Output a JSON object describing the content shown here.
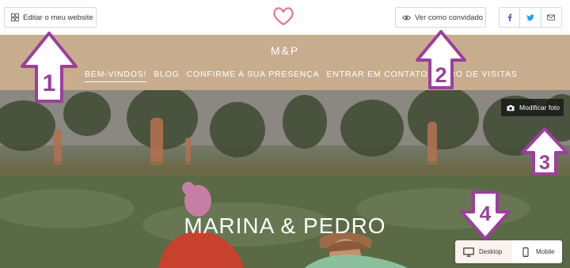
{
  "topbar": {
    "edit_label": "Editar o meu website",
    "edit_icon": "grid-icon",
    "guest_label": "Ver como convidado",
    "guest_icon": "eye-icon",
    "share": [
      "facebook-icon",
      "twitter-icon",
      "mail-icon"
    ]
  },
  "header": {
    "monogram": "M&P",
    "nav": [
      "BEM-VINDOS!",
      "BLOG",
      "CONFIRME A SUA PRESENÇA",
      "ENTRAR EM CONTATO",
      "LIVRO DE VISITAS"
    ]
  },
  "hero": {
    "title": "MARINA & PEDRO",
    "photo_button": "Modificar foto",
    "desktop_label": "Desktop",
    "mobile_label": "Mobile"
  },
  "annotations": {
    "labels": [
      "1",
      "2",
      "3",
      "4"
    ],
    "color": "#9b3f9c"
  },
  "colors": {
    "header_band": "#c7ad8e",
    "heart": "#e47a8a",
    "social_blue": "#3b5998"
  }
}
